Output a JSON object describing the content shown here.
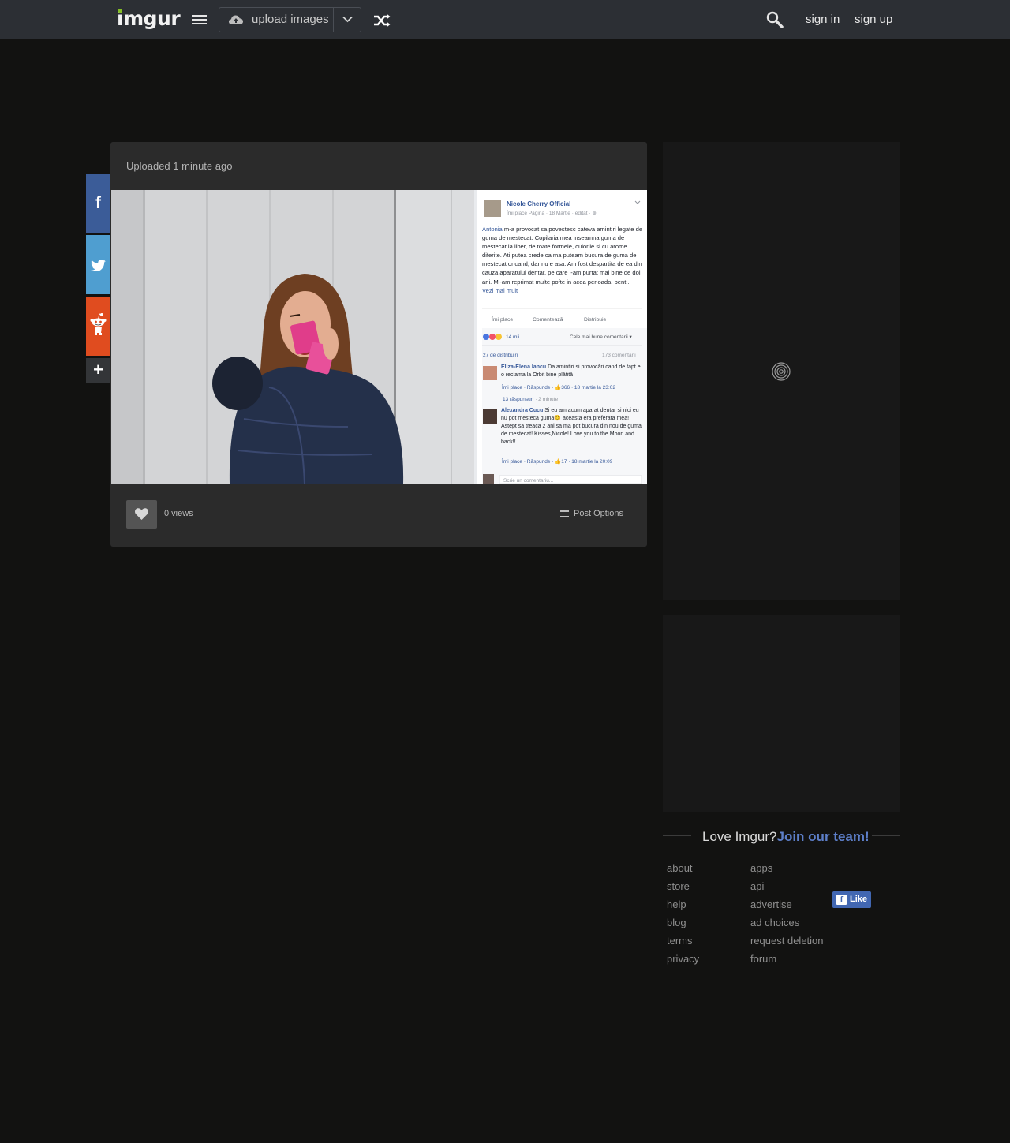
{
  "header": {
    "logo": "imgur",
    "upload_label": "upload images",
    "sign_in": "sign in",
    "sign_up": "sign up",
    "icons": [
      "menu-icon",
      "cloud-upload-icon",
      "chevron-down-icon",
      "random-icon",
      "search-icon"
    ]
  },
  "social": {
    "facebook": "f",
    "more": "+",
    "icons": [
      "facebook-icon",
      "twitter-icon",
      "reddit-icon",
      "plus-icon"
    ]
  },
  "post": {
    "uploaded_label": "Uploaded",
    "uploaded_time": "1 minute ago",
    "views": "0 views",
    "post_options": "Post Options",
    "image": {
      "page_name": "Nicole Cherry Official",
      "page_meta": "Îmi place Pagina · 18 Martie · editat · ⊕",
      "post_author_link": "Antonia",
      "post_text": " m-a provocat sa povestesc cateva amintiri legate de guma de mestecat. Copilaria mea inseamna guma de mestecat la liber, de toate formele, culorile si cu arome diferite. Ati putea crede ca ma puteam bucura de guma de mestecat oricand, dar nu e asa. Am fost despartita de ea din cauza aparatului dentar, pe care l-am purtat mai bine de doi ani. Mi-am reprimat multe pofte in acea perioada, pent...",
      "see_more": "Vezi mai mult",
      "actions": [
        "Îmi place",
        "Comentează",
        "Distribuie"
      ],
      "reactions_count": "14 mii",
      "sort_label": "Cele mai bune comentarii ▾",
      "shares": "27 de distribuiri",
      "comments_count": "173 comentarii",
      "comments": [
        {
          "name": "Eliza-Elena Iancu",
          "text": " Da amintiri si provocări cand de fapt e o reclama la Orbit bine plătită",
          "meta": "Îmi place · Răspunde · 👍366 · 18 martie la 23:02"
        },
        {
          "name": "Alexandra Cucu",
          "text": " Si eu am acum aparat dentar si nici eu nu pot mesteca guma😊 aceasta era preferata mea! Astept sa treaca 2 ani sa ma pot bucura din nou de guma de mestecat! Kisses,Nicole! Love you to the Moon and back!!",
          "meta": "Îmi place · Răspunde · 👍17 · 18 martie la 20:09"
        }
      ],
      "replies": "13 răspunsuri",
      "replies_time": " · 2 minute",
      "write_comment": "Scrie un comentariu..."
    }
  },
  "footer": {
    "love_text": "Love Imgur?",
    "join_text": "Join our team!",
    "col1": [
      "about",
      "store",
      "help",
      "blog",
      "terms",
      "privacy"
    ],
    "col2": [
      "apps",
      "api",
      "advertise",
      "ad choices",
      "request deletion",
      "forum"
    ],
    "fb_like": "Like"
  },
  "colors": {
    "topbar": "#2c2f34",
    "background": "#121211",
    "panel": "#2b2b2b",
    "accent_green": "#85bf25",
    "link_blue": "#5d7fc9",
    "facebook": "#3b5c98",
    "twitter": "#4f9ed0",
    "reddit": "#e04c1f"
  }
}
